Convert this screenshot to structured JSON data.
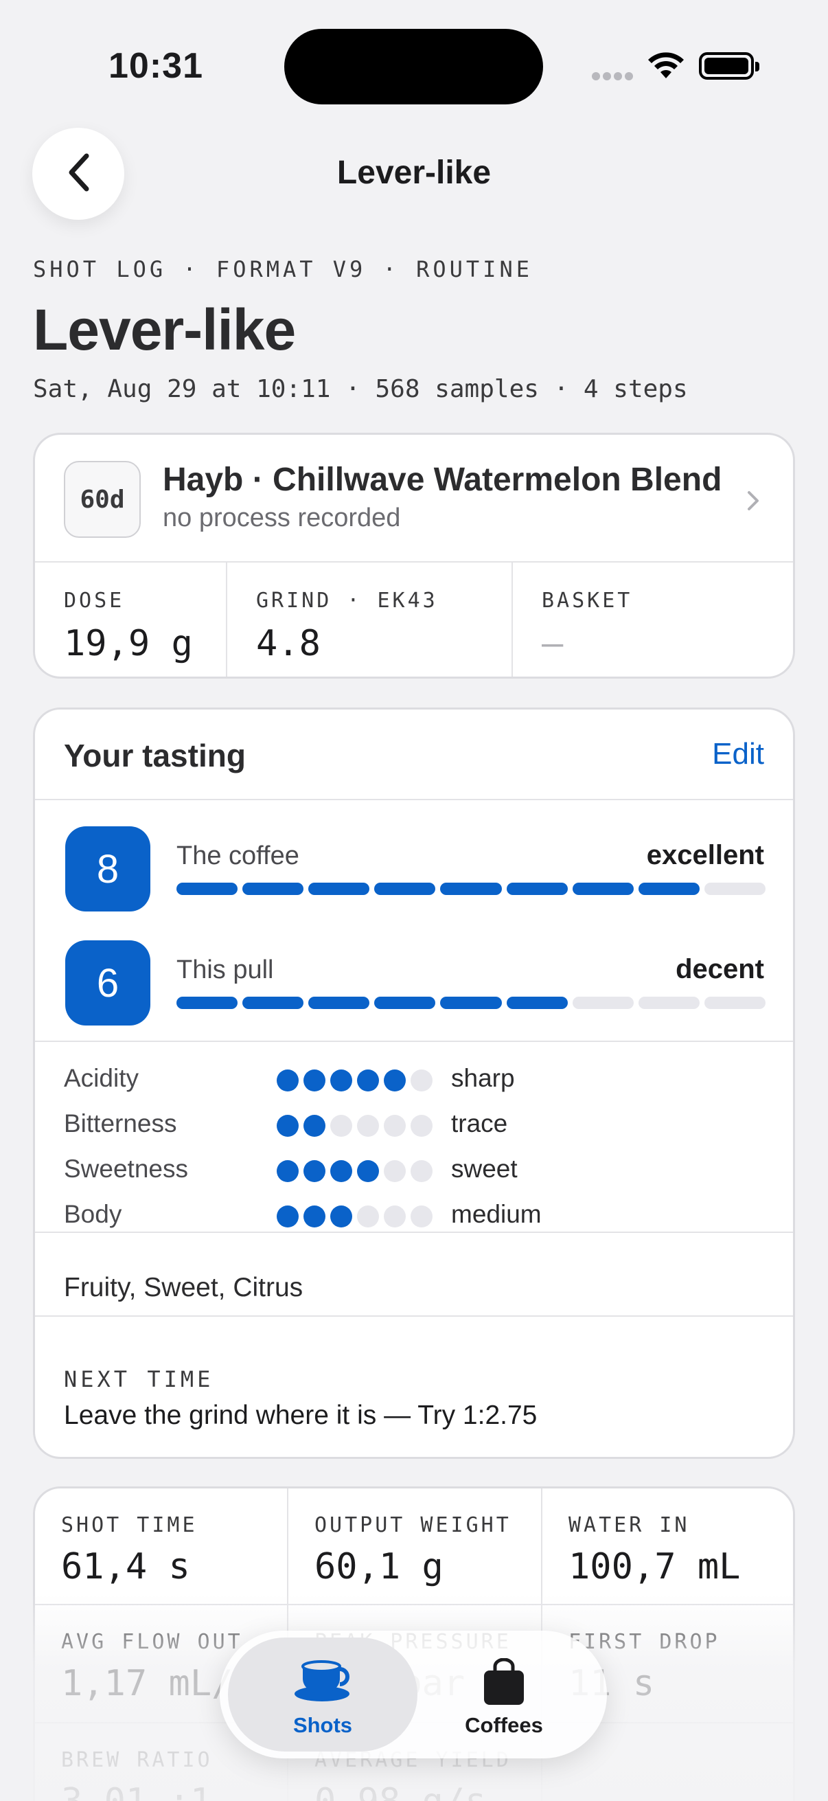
{
  "status_bar": {
    "time": "10:31"
  },
  "nav": {
    "title": "Lever-like"
  },
  "header": {
    "eyebrow": "SHOT LOG · FORMAT V9 · ROUTINE",
    "title": "Lever-like",
    "meta": "Sat, Aug 29 at 10:11 · 568 samples · 4 steps"
  },
  "coffee": {
    "age": "60d",
    "name": "Hayb · Chillwave Watermelon Blend",
    "process": "no process recorded",
    "params": [
      {
        "label": "DOSE",
        "value": "19,9 g"
      },
      {
        "label": "GRIND · EK43",
        "value": "4.8"
      },
      {
        "label": "BASKET",
        "value": "—"
      }
    ]
  },
  "tasting": {
    "title": "Your tasting",
    "edit_label": "Edit",
    "scores": [
      {
        "score": "8",
        "label": "The coffee",
        "word": "excellent",
        "filled": 8,
        "max": 9
      },
      {
        "score": "6",
        "label": "This pull",
        "word": "decent",
        "filled": 6,
        "max": 9
      }
    ],
    "attributes": [
      {
        "name": "Acidity",
        "level": 5,
        "max": 6,
        "word": "sharp"
      },
      {
        "name": "Bitterness",
        "level": 2,
        "max": 6,
        "word": "trace"
      },
      {
        "name": "Sweetness",
        "level": 4,
        "max": 6,
        "word": "sweet"
      },
      {
        "name": "Body",
        "level": 3,
        "max": 6,
        "word": "medium"
      }
    ],
    "notes": "Fruity, Sweet, Citrus",
    "next_time_label": "NEXT TIME",
    "next_time": "Leave the grind where it is — Try 1:2.75"
  },
  "metrics": [
    {
      "label": "SHOT TIME",
      "value": "61,4 s"
    },
    {
      "label": "OUTPUT WEIGHT",
      "value": "60,1 g"
    },
    {
      "label": "WATER IN",
      "value": "100,7 mL"
    },
    {
      "label": "AVG FLOW OUT",
      "value": "1,17 mL/s"
    },
    {
      "label": "PEAK PRESSURE",
      "value": "8,7 bar"
    },
    {
      "label": "FIRST DROP",
      "value": "11 s"
    },
    {
      "label": "BREW RATIO",
      "value": "3,01 :1"
    },
    {
      "label": "AVERAGE YIELD",
      "value": "0,98 g/s"
    },
    {
      "label": "",
      "value": ""
    }
  ],
  "tabbar": {
    "tabs": [
      {
        "label": "Shots",
        "icon": "cup-icon",
        "active": true
      },
      {
        "label": "Coffees",
        "icon": "bag-icon",
        "active": false
      }
    ]
  },
  "colors": {
    "accent": "#0a62c9",
    "background": "#f2f2f4",
    "track": "#e7e7ec"
  }
}
